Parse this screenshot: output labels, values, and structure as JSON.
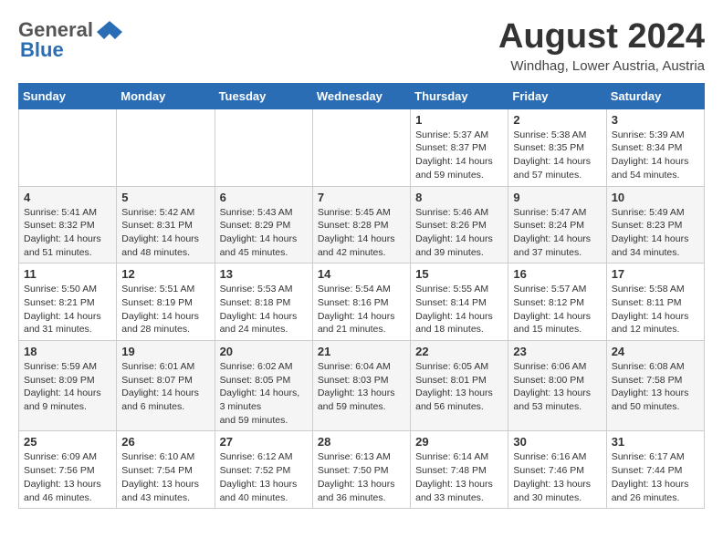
{
  "header": {
    "logo_general": "General",
    "logo_blue": "Blue",
    "month_year": "August 2024",
    "location": "Windhag, Lower Austria, Austria"
  },
  "days_of_week": [
    "Sunday",
    "Monday",
    "Tuesday",
    "Wednesday",
    "Thursday",
    "Friday",
    "Saturday"
  ],
  "weeks": [
    [
      {
        "day": "",
        "content": ""
      },
      {
        "day": "",
        "content": ""
      },
      {
        "day": "",
        "content": ""
      },
      {
        "day": "",
        "content": ""
      },
      {
        "day": "1",
        "content": "Sunrise: 5:37 AM\nSunset: 8:37 PM\nDaylight: 14 hours\nand 59 minutes."
      },
      {
        "day": "2",
        "content": "Sunrise: 5:38 AM\nSunset: 8:35 PM\nDaylight: 14 hours\nand 57 minutes."
      },
      {
        "day": "3",
        "content": "Sunrise: 5:39 AM\nSunset: 8:34 PM\nDaylight: 14 hours\nand 54 minutes."
      }
    ],
    [
      {
        "day": "4",
        "content": "Sunrise: 5:41 AM\nSunset: 8:32 PM\nDaylight: 14 hours\nand 51 minutes."
      },
      {
        "day": "5",
        "content": "Sunrise: 5:42 AM\nSunset: 8:31 PM\nDaylight: 14 hours\nand 48 minutes."
      },
      {
        "day": "6",
        "content": "Sunrise: 5:43 AM\nSunset: 8:29 PM\nDaylight: 14 hours\nand 45 minutes."
      },
      {
        "day": "7",
        "content": "Sunrise: 5:45 AM\nSunset: 8:28 PM\nDaylight: 14 hours\nand 42 minutes."
      },
      {
        "day": "8",
        "content": "Sunrise: 5:46 AM\nSunset: 8:26 PM\nDaylight: 14 hours\nand 39 minutes."
      },
      {
        "day": "9",
        "content": "Sunrise: 5:47 AM\nSunset: 8:24 PM\nDaylight: 14 hours\nand 37 minutes."
      },
      {
        "day": "10",
        "content": "Sunrise: 5:49 AM\nSunset: 8:23 PM\nDaylight: 14 hours\nand 34 minutes."
      }
    ],
    [
      {
        "day": "11",
        "content": "Sunrise: 5:50 AM\nSunset: 8:21 PM\nDaylight: 14 hours\nand 31 minutes."
      },
      {
        "day": "12",
        "content": "Sunrise: 5:51 AM\nSunset: 8:19 PM\nDaylight: 14 hours\nand 28 minutes."
      },
      {
        "day": "13",
        "content": "Sunrise: 5:53 AM\nSunset: 8:18 PM\nDaylight: 14 hours\nand 24 minutes."
      },
      {
        "day": "14",
        "content": "Sunrise: 5:54 AM\nSunset: 8:16 PM\nDaylight: 14 hours\nand 21 minutes."
      },
      {
        "day": "15",
        "content": "Sunrise: 5:55 AM\nSunset: 8:14 PM\nDaylight: 14 hours\nand 18 minutes."
      },
      {
        "day": "16",
        "content": "Sunrise: 5:57 AM\nSunset: 8:12 PM\nDaylight: 14 hours\nand 15 minutes."
      },
      {
        "day": "17",
        "content": "Sunrise: 5:58 AM\nSunset: 8:11 PM\nDaylight: 14 hours\nand 12 minutes."
      }
    ],
    [
      {
        "day": "18",
        "content": "Sunrise: 5:59 AM\nSunset: 8:09 PM\nDaylight: 14 hours\nand 9 minutes."
      },
      {
        "day": "19",
        "content": "Sunrise: 6:01 AM\nSunset: 8:07 PM\nDaylight: 14 hours\nand 6 minutes."
      },
      {
        "day": "20",
        "content": "Sunrise: 6:02 AM\nSunset: 8:05 PM\nDaylight: 14 hours, 3 minutes\nand 59 minutes."
      },
      {
        "day": "21",
        "content": "Sunrise: 6:04 AM\nSunset: 8:03 PM\nDaylight: 13 hours\nand 59 minutes."
      },
      {
        "day": "22",
        "content": "Sunrise: 6:05 AM\nSunset: 8:01 PM\nDaylight: 13 hours\nand 56 minutes."
      },
      {
        "day": "23",
        "content": "Sunrise: 6:06 AM\nSunset: 8:00 PM\nDaylight: 13 hours\nand 53 minutes."
      },
      {
        "day": "24",
        "content": "Sunrise: 6:08 AM\nSunset: 7:58 PM\nDaylight: 13 hours\nand 50 minutes."
      }
    ],
    [
      {
        "day": "25",
        "content": "Sunrise: 6:09 AM\nSunset: 7:56 PM\nDaylight: 13 hours\nand 46 minutes."
      },
      {
        "day": "26",
        "content": "Sunrise: 6:10 AM\nSunset: 7:54 PM\nDaylight: 13 hours\nand 43 minutes."
      },
      {
        "day": "27",
        "content": "Sunrise: 6:12 AM\nSunset: 7:52 PM\nDaylight: 13 hours\nand 40 minutes."
      },
      {
        "day": "28",
        "content": "Sunrise: 6:13 AM\nSunset: 7:50 PM\nDaylight: 13 hours\nand 36 minutes."
      },
      {
        "day": "29",
        "content": "Sunrise: 6:14 AM\nSunset: 7:48 PM\nDaylight: 13 hours\nand 33 minutes."
      },
      {
        "day": "30",
        "content": "Sunrise: 6:16 AM\nSunset: 7:46 PM\nDaylight: 13 hours\nand 30 minutes."
      },
      {
        "day": "31",
        "content": "Sunrise: 6:17 AM\nSunset: 7:44 PM\nDaylight: 13 hours\nand 26 minutes."
      }
    ]
  ]
}
